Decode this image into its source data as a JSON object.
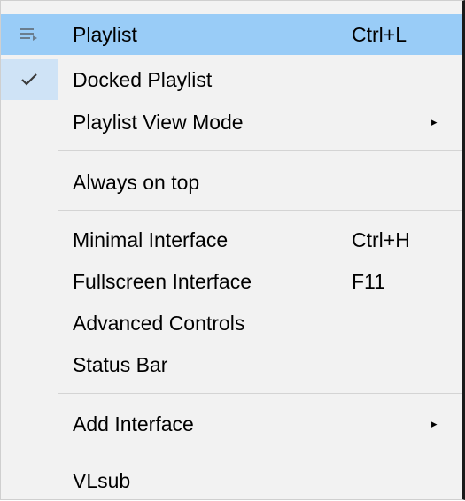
{
  "menu": {
    "items": [
      {
        "label": "Playlist",
        "shortcut": "Ctrl+L",
        "icon": "playlist-icon",
        "highlighted": true
      },
      {
        "label": "Docked Playlist",
        "checked": true,
        "icon": "check-icon"
      },
      {
        "label": "Playlist View Mode",
        "submenu": true,
        "arrow": "▸"
      },
      {
        "label": "Always on top"
      },
      {
        "label": "Minimal Interface",
        "shortcut": "Ctrl+H"
      },
      {
        "label": "Fullscreen Interface",
        "shortcut": "F11"
      },
      {
        "label": "Advanced Controls"
      },
      {
        "label": "Status Bar"
      },
      {
        "label": "Add Interface",
        "submenu": true,
        "arrow": "▸"
      },
      {
        "label": "VLsub"
      }
    ],
    "colors": {
      "highlight": "#99ccf7",
      "check_background": "#cfe3f6",
      "menu_background": "#f2f2f2"
    }
  }
}
